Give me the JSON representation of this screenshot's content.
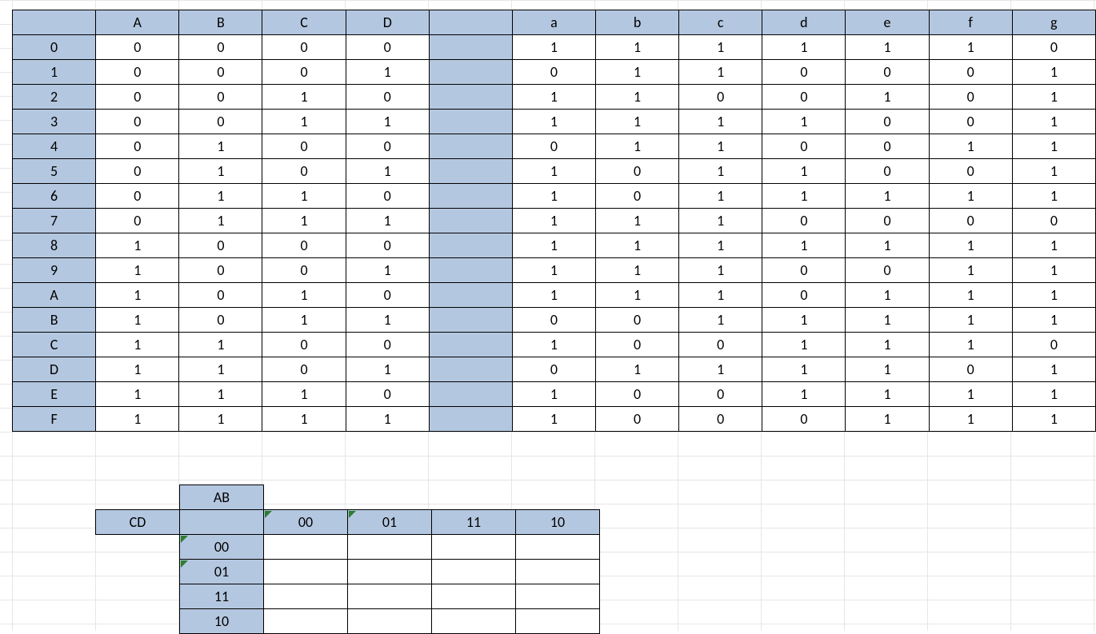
{
  "colors": {
    "header_bg": "#b4c7e0",
    "border": "#000000",
    "grid": "#e6e6e6",
    "error_triangle": "#2e7d32"
  },
  "truth_table": {
    "input_headers": [
      "A",
      "B",
      "C",
      "D"
    ],
    "output_headers": [
      "a",
      "b",
      "c",
      "d",
      "e",
      "f",
      "g"
    ],
    "row_labels": [
      "0",
      "1",
      "2",
      "3",
      "4",
      "5",
      "6",
      "7",
      "8",
      "9",
      "A",
      "B",
      "C",
      "D",
      "E",
      "F"
    ],
    "inputs": [
      [
        "0",
        "0",
        "0",
        "0"
      ],
      [
        "0",
        "0",
        "0",
        "1"
      ],
      [
        "0",
        "0",
        "1",
        "0"
      ],
      [
        "0",
        "0",
        "1",
        "1"
      ],
      [
        "0",
        "1",
        "0",
        "0"
      ],
      [
        "0",
        "1",
        "0",
        "1"
      ],
      [
        "0",
        "1",
        "1",
        "0"
      ],
      [
        "0",
        "1",
        "1",
        "1"
      ],
      [
        "1",
        "0",
        "0",
        "0"
      ],
      [
        "1",
        "0",
        "0",
        "1"
      ],
      [
        "1",
        "0",
        "1",
        "0"
      ],
      [
        "1",
        "0",
        "1",
        "1"
      ],
      [
        "1",
        "1",
        "0",
        "0"
      ],
      [
        "1",
        "1",
        "0",
        "1"
      ],
      [
        "1",
        "1",
        "1",
        "0"
      ],
      [
        "1",
        "1",
        "1",
        "1"
      ]
    ],
    "outputs": [
      [
        "1",
        "1",
        "1",
        "1",
        "1",
        "1",
        "0"
      ],
      [
        "0",
        "1",
        "1",
        "0",
        "0",
        "0",
        "1"
      ],
      [
        "1",
        "1",
        "0",
        "0",
        "1",
        "0",
        "1"
      ],
      [
        "1",
        "1",
        "1",
        "1",
        "0",
        "0",
        "1"
      ],
      [
        "0",
        "1",
        "1",
        "0",
        "0",
        "1",
        "1"
      ],
      [
        "1",
        "0",
        "1",
        "1",
        "0",
        "0",
        "1"
      ],
      [
        "1",
        "0",
        "1",
        "1",
        "1",
        "1",
        "1"
      ],
      [
        "1",
        "1",
        "1",
        "0",
        "0",
        "0",
        "0"
      ],
      [
        "1",
        "1",
        "1",
        "1",
        "1",
        "1",
        "1"
      ],
      [
        "1",
        "1",
        "1",
        "0",
        "0",
        "1",
        "1"
      ],
      [
        "1",
        "1",
        "1",
        "0",
        "1",
        "1",
        "1"
      ],
      [
        "0",
        "0",
        "1",
        "1",
        "1",
        "1",
        "1"
      ],
      [
        "1",
        "0",
        "0",
        "1",
        "1",
        "1",
        "0"
      ],
      [
        "0",
        "1",
        "1",
        "1",
        "1",
        "0",
        "1"
      ],
      [
        "1",
        "0",
        "0",
        "1",
        "1",
        "1",
        "1"
      ],
      [
        "1",
        "0",
        "0",
        "0",
        "1",
        "1",
        "1"
      ]
    ]
  },
  "kmap": {
    "var_cols_label": "AB",
    "var_rows_label": "CD",
    "col_headers": [
      "00",
      "01",
      "11",
      "10"
    ],
    "row_headers": [
      "00",
      "01",
      "11",
      "10"
    ],
    "cells": [
      [
        "",
        "",
        "",
        ""
      ],
      [
        "",
        "",
        "",
        ""
      ],
      [
        "",
        "",
        "",
        ""
      ],
      [
        "",
        "",
        "",
        ""
      ]
    ]
  }
}
